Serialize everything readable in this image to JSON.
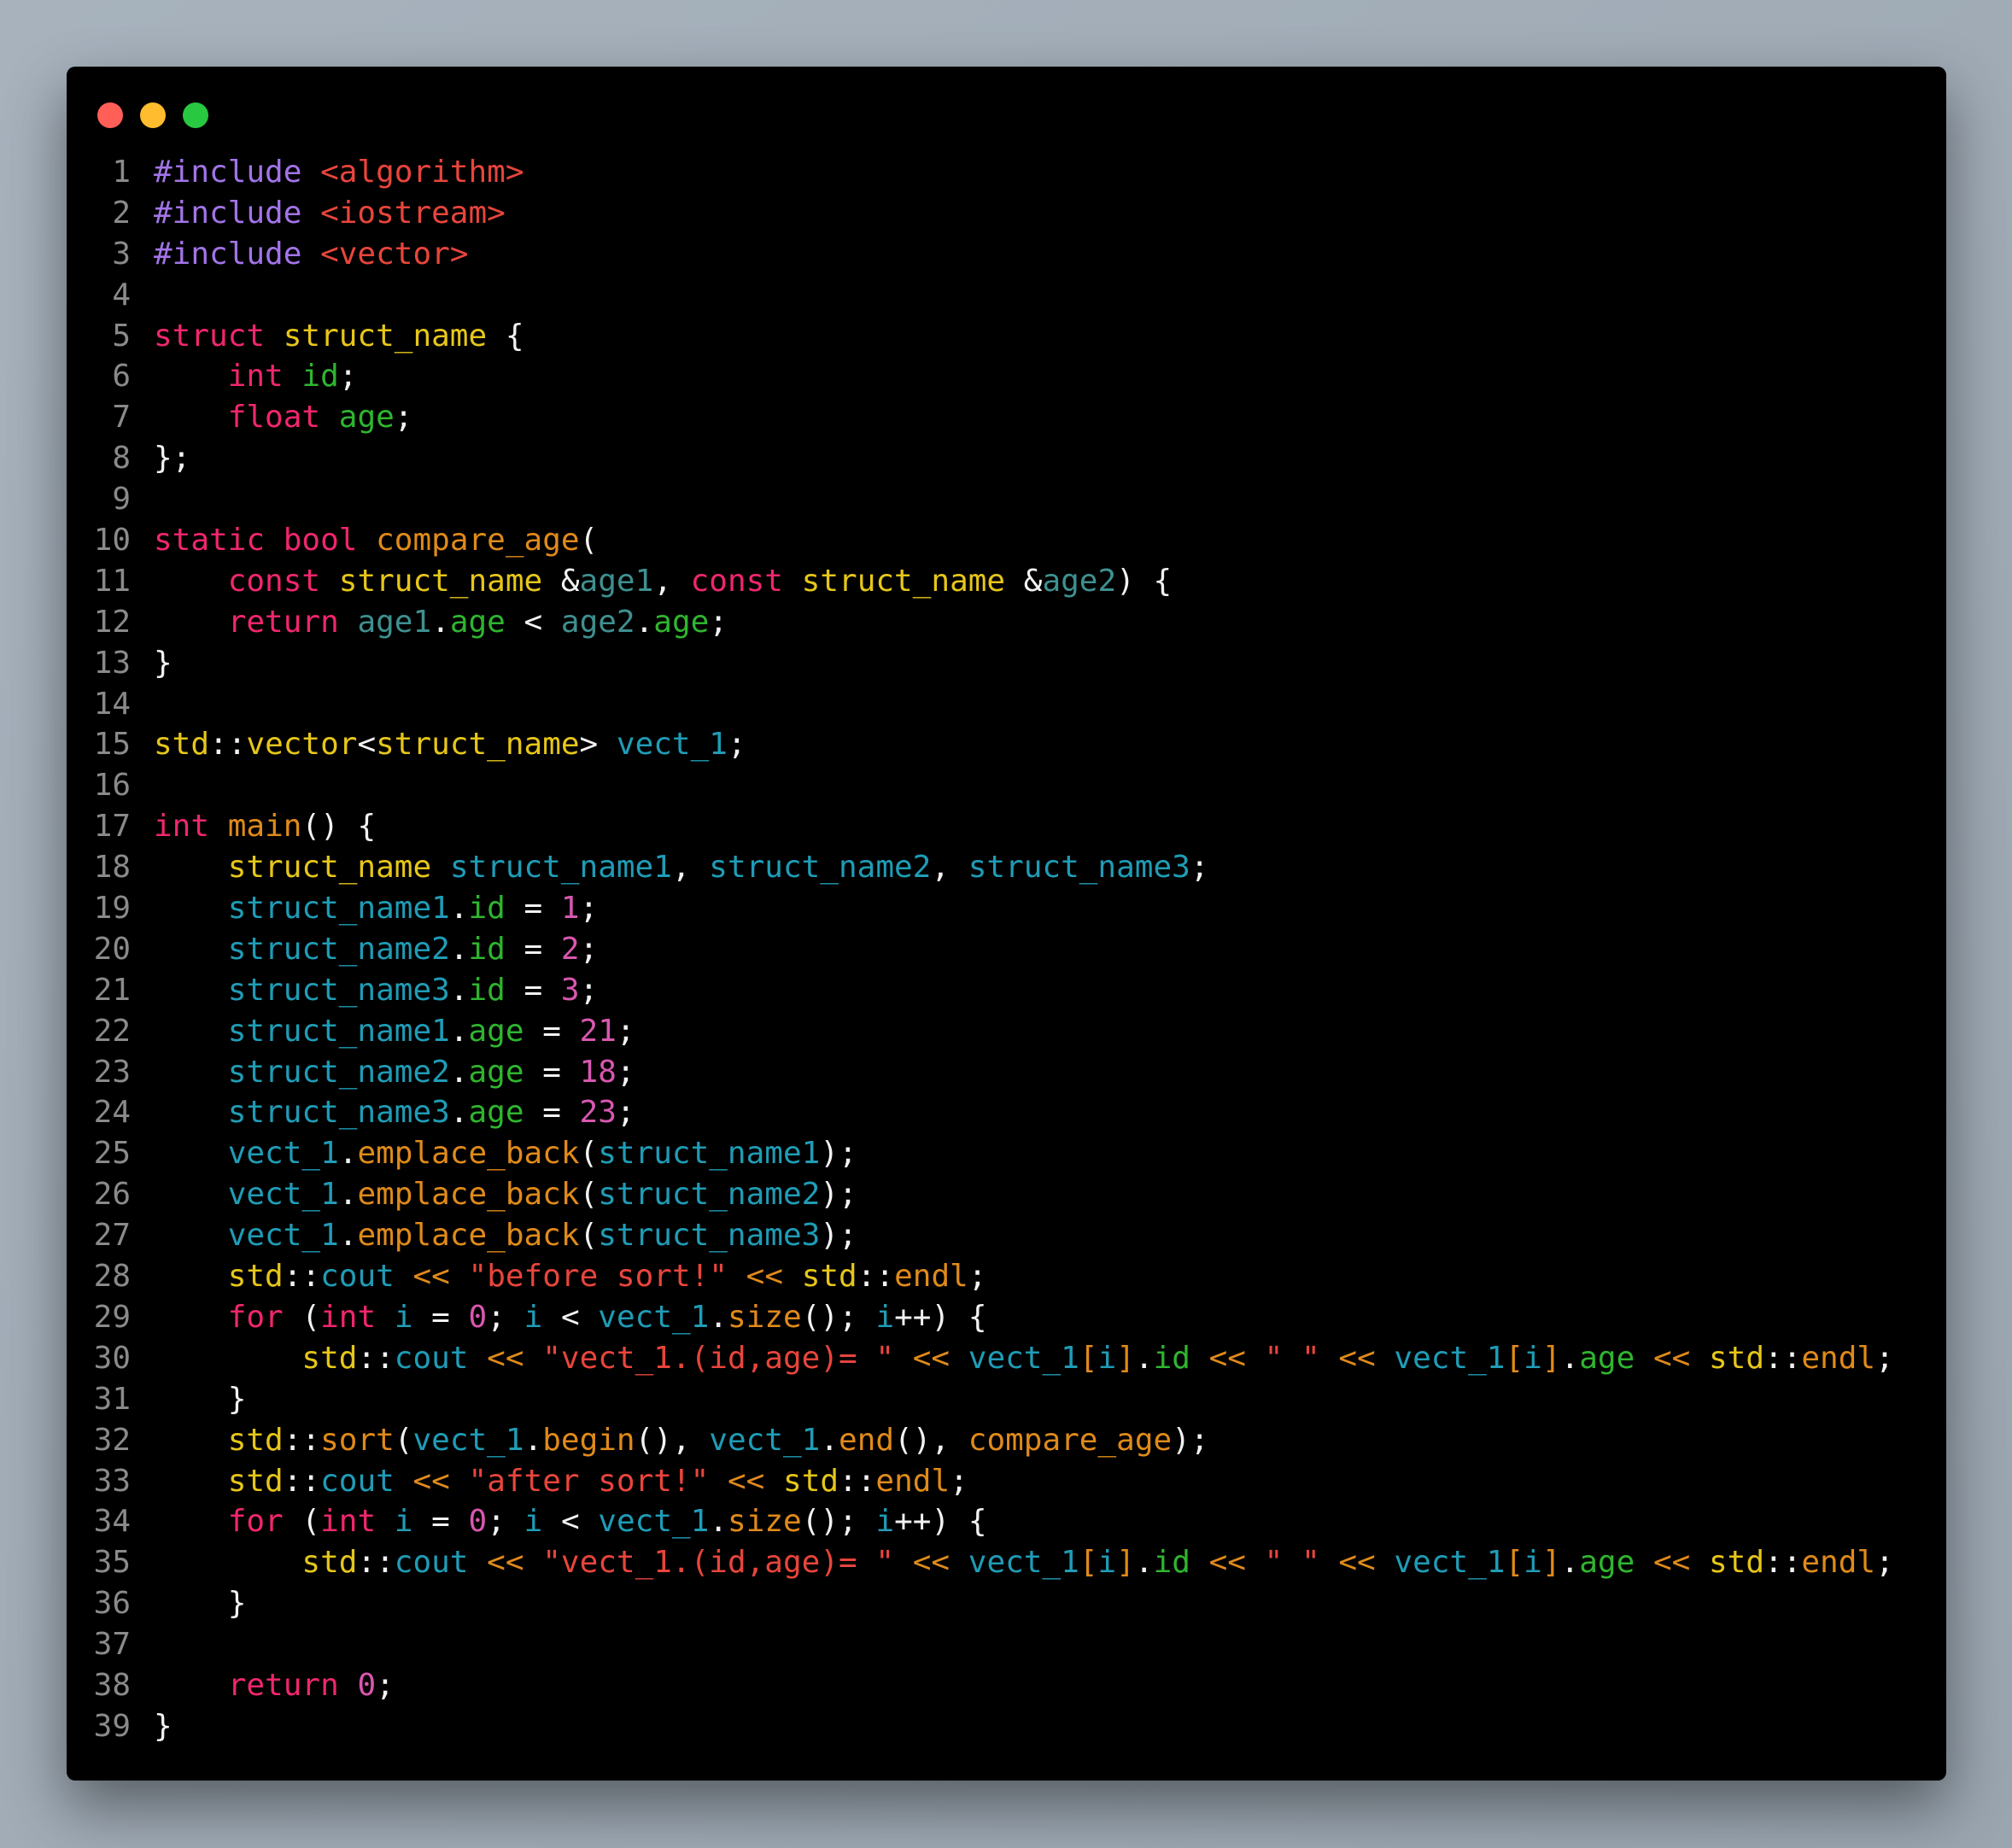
{
  "window": {
    "controls": [
      {
        "name": "close",
        "color": "#ff5f57"
      },
      {
        "name": "minimize",
        "color": "#febc2e"
      },
      {
        "name": "maximize",
        "color": "#28c840"
      }
    ]
  },
  "colors": {
    "keyword": "#f0266e",
    "type": "#e6c619",
    "function": "#e08a1a",
    "parameter": "#3f9090",
    "member": "#2fb52f",
    "variable": "#1f9cb6",
    "number": "#d957b0",
    "string": "#e8453c",
    "preprocessor": "#a274e8",
    "line_number": "#8a8a8a"
  },
  "code": {
    "language": "cpp",
    "lines": [
      [
        [
          "pp",
          "#include"
        ],
        [
          "pl",
          " "
        ],
        [
          "st",
          "<algorithm>"
        ]
      ],
      [
        [
          "pp",
          "#include"
        ],
        [
          "pl",
          " "
        ],
        [
          "st",
          "<iostream>"
        ]
      ],
      [
        [
          "pp",
          "#include"
        ],
        [
          "pl",
          " "
        ],
        [
          "st",
          "<vector>"
        ]
      ],
      [],
      [
        [
          "kw",
          "struct"
        ],
        [
          "pl",
          " "
        ],
        [
          "ty",
          "struct_name"
        ],
        [
          "pl",
          " {"
        ]
      ],
      [
        [
          "pl",
          "    "
        ],
        [
          "kw",
          "int"
        ],
        [
          "pl",
          " "
        ],
        [
          "me",
          "id"
        ],
        [
          "pl",
          ";"
        ]
      ],
      [
        [
          "pl",
          "    "
        ],
        [
          "kw",
          "float"
        ],
        [
          "pl",
          " "
        ],
        [
          "me",
          "age"
        ],
        [
          "pl",
          ";"
        ]
      ],
      [
        [
          "pl",
          "};"
        ]
      ],
      [],
      [
        [
          "kw",
          "static"
        ],
        [
          "pl",
          " "
        ],
        [
          "kw",
          "bool"
        ],
        [
          "pl",
          " "
        ],
        [
          "fn",
          "compare_age"
        ],
        [
          "pl",
          "("
        ]
      ],
      [
        [
          "pl",
          "    "
        ],
        [
          "kw",
          "const"
        ],
        [
          "pl",
          " "
        ],
        [
          "ty",
          "struct_name"
        ],
        [
          "pl",
          " &"
        ],
        [
          "pa",
          "age1"
        ],
        [
          "pl",
          ", "
        ],
        [
          "kw",
          "const"
        ],
        [
          "pl",
          " "
        ],
        [
          "ty",
          "struct_name"
        ],
        [
          "pl",
          " &"
        ],
        [
          "pa",
          "age2"
        ],
        [
          "pl",
          ") {"
        ]
      ],
      [
        [
          "pl",
          "    "
        ],
        [
          "kw",
          "return"
        ],
        [
          "pl",
          " "
        ],
        [
          "pa",
          "age1"
        ],
        [
          "pl",
          "."
        ],
        [
          "me",
          "age"
        ],
        [
          "pl",
          " < "
        ],
        [
          "pa",
          "age2"
        ],
        [
          "pl",
          "."
        ],
        [
          "me",
          "age"
        ],
        [
          "pl",
          ";"
        ]
      ],
      [
        [
          "pl",
          "}"
        ]
      ],
      [],
      [
        [
          "ns",
          "std"
        ],
        [
          "pl",
          "::"
        ],
        [
          "ty",
          "vector"
        ],
        [
          "pl",
          "<"
        ],
        [
          "ty",
          "struct_name"
        ],
        [
          "pl",
          "> "
        ],
        [
          "va",
          "vect_1"
        ],
        [
          "pl",
          ";"
        ]
      ],
      [],
      [
        [
          "kw",
          "int"
        ],
        [
          "pl",
          " "
        ],
        [
          "fn",
          "main"
        ],
        [
          "pl",
          "() {"
        ]
      ],
      [
        [
          "pl",
          "    "
        ],
        [
          "ty",
          "struct_name"
        ],
        [
          "pl",
          " "
        ],
        [
          "va",
          "struct_name1"
        ],
        [
          "pl",
          ", "
        ],
        [
          "va",
          "struct_name2"
        ],
        [
          "pl",
          ", "
        ],
        [
          "va",
          "struct_name3"
        ],
        [
          "pl",
          ";"
        ]
      ],
      [
        [
          "pl",
          "    "
        ],
        [
          "va",
          "struct_name1"
        ],
        [
          "pl",
          "."
        ],
        [
          "me",
          "id"
        ],
        [
          "pl",
          " = "
        ],
        [
          "nu",
          "1"
        ],
        [
          "pl",
          ";"
        ]
      ],
      [
        [
          "pl",
          "    "
        ],
        [
          "va",
          "struct_name2"
        ],
        [
          "pl",
          "."
        ],
        [
          "me",
          "id"
        ],
        [
          "pl",
          " = "
        ],
        [
          "nu",
          "2"
        ],
        [
          "pl",
          ";"
        ]
      ],
      [
        [
          "pl",
          "    "
        ],
        [
          "va",
          "struct_name3"
        ],
        [
          "pl",
          "."
        ],
        [
          "me",
          "id"
        ],
        [
          "pl",
          " = "
        ],
        [
          "nu",
          "3"
        ],
        [
          "pl",
          ";"
        ]
      ],
      [
        [
          "pl",
          "    "
        ],
        [
          "va",
          "struct_name1"
        ],
        [
          "pl",
          "."
        ],
        [
          "me",
          "age"
        ],
        [
          "pl",
          " = "
        ],
        [
          "nu",
          "21"
        ],
        [
          "pl",
          ";"
        ]
      ],
      [
        [
          "pl",
          "    "
        ],
        [
          "va",
          "struct_name2"
        ],
        [
          "pl",
          "."
        ],
        [
          "me",
          "age"
        ],
        [
          "pl",
          " = "
        ],
        [
          "nu",
          "18"
        ],
        [
          "pl",
          ";"
        ]
      ],
      [
        [
          "pl",
          "    "
        ],
        [
          "va",
          "struct_name3"
        ],
        [
          "pl",
          "."
        ],
        [
          "me",
          "age"
        ],
        [
          "pl",
          " = "
        ],
        [
          "nu",
          "23"
        ],
        [
          "pl",
          ";"
        ]
      ],
      [
        [
          "pl",
          "    "
        ],
        [
          "va",
          "vect_1"
        ],
        [
          "pl",
          "."
        ],
        [
          "fn",
          "emplace_back"
        ],
        [
          "pl",
          "("
        ],
        [
          "va",
          "struct_name1"
        ],
        [
          "pl",
          ");"
        ]
      ],
      [
        [
          "pl",
          "    "
        ],
        [
          "va",
          "vect_1"
        ],
        [
          "pl",
          "."
        ],
        [
          "fn",
          "emplace_back"
        ],
        [
          "pl",
          "("
        ],
        [
          "va",
          "struct_name2"
        ],
        [
          "pl",
          ");"
        ]
      ],
      [
        [
          "pl",
          "    "
        ],
        [
          "va",
          "vect_1"
        ],
        [
          "pl",
          "."
        ],
        [
          "fn",
          "emplace_back"
        ],
        [
          "pl",
          "("
        ],
        [
          "va",
          "struct_name3"
        ],
        [
          "pl",
          ");"
        ]
      ],
      [
        [
          "pl",
          "    "
        ],
        [
          "ns",
          "std"
        ],
        [
          "pl",
          "::"
        ],
        [
          "va",
          "cout"
        ],
        [
          "pl",
          " "
        ],
        [
          "op",
          "<<"
        ],
        [
          "pl",
          " "
        ],
        [
          "st",
          "\"before sort!\""
        ],
        [
          "pl",
          " "
        ],
        [
          "op",
          "<<"
        ],
        [
          "pl",
          " "
        ],
        [
          "ns",
          "std"
        ],
        [
          "pl",
          "::"
        ],
        [
          "fn",
          "endl"
        ],
        [
          "pl",
          ";"
        ]
      ],
      [
        [
          "pl",
          "    "
        ],
        [
          "kw",
          "for"
        ],
        [
          "pl",
          " ("
        ],
        [
          "kw",
          "int"
        ],
        [
          "pl",
          " "
        ],
        [
          "va",
          "i"
        ],
        [
          "pl",
          " = "
        ],
        [
          "nu",
          "0"
        ],
        [
          "pl",
          "; "
        ],
        [
          "va",
          "i"
        ],
        [
          "pl",
          " < "
        ],
        [
          "va",
          "vect_1"
        ],
        [
          "pl",
          "."
        ],
        [
          "fn",
          "size"
        ],
        [
          "pl",
          "(); "
        ],
        [
          "va",
          "i"
        ],
        [
          "pl",
          "++) {"
        ]
      ],
      [
        [
          "pl",
          "        "
        ],
        [
          "ns",
          "std"
        ],
        [
          "pl",
          "::"
        ],
        [
          "va",
          "cout"
        ],
        [
          "pl",
          " "
        ],
        [
          "op",
          "<<"
        ],
        [
          "pl",
          " "
        ],
        [
          "st",
          "\"vect_1.(id,age)= \""
        ],
        [
          "pl",
          " "
        ],
        [
          "op",
          "<<"
        ],
        [
          "pl",
          " "
        ],
        [
          "va",
          "vect_1"
        ],
        [
          "op",
          "["
        ],
        [
          "va",
          "i"
        ],
        [
          "op",
          "]"
        ],
        [
          "pl",
          "."
        ],
        [
          "me",
          "id"
        ],
        [
          "pl",
          " "
        ],
        [
          "op",
          "<<"
        ],
        [
          "pl",
          " "
        ],
        [
          "st",
          "\" \""
        ],
        [
          "pl",
          " "
        ],
        [
          "op",
          "<<"
        ],
        [
          "pl",
          " "
        ],
        [
          "va",
          "vect_1"
        ],
        [
          "op",
          "["
        ],
        [
          "va",
          "i"
        ],
        [
          "op",
          "]"
        ],
        [
          "pl",
          "."
        ],
        [
          "me",
          "age"
        ],
        [
          "pl",
          " "
        ],
        [
          "op",
          "<<"
        ],
        [
          "pl",
          " "
        ],
        [
          "ns",
          "std"
        ],
        [
          "pl",
          "::"
        ],
        [
          "fn",
          "endl"
        ],
        [
          "pl",
          ";"
        ]
      ],
      [
        [
          "pl",
          "    }"
        ]
      ],
      [
        [
          "pl",
          "    "
        ],
        [
          "ns",
          "std"
        ],
        [
          "pl",
          "::"
        ],
        [
          "fn",
          "sort"
        ],
        [
          "pl",
          "("
        ],
        [
          "va",
          "vect_1"
        ],
        [
          "pl",
          "."
        ],
        [
          "fn",
          "begin"
        ],
        [
          "pl",
          "(), "
        ],
        [
          "va",
          "vect_1"
        ],
        [
          "pl",
          "."
        ],
        [
          "fn",
          "end"
        ],
        [
          "pl",
          "(), "
        ],
        [
          "fn",
          "compare_age"
        ],
        [
          "pl",
          ");"
        ]
      ],
      [
        [
          "pl",
          "    "
        ],
        [
          "ns",
          "std"
        ],
        [
          "pl",
          "::"
        ],
        [
          "va",
          "cout"
        ],
        [
          "pl",
          " "
        ],
        [
          "op",
          "<<"
        ],
        [
          "pl",
          " "
        ],
        [
          "st",
          "\"after sort!\""
        ],
        [
          "pl",
          " "
        ],
        [
          "op",
          "<<"
        ],
        [
          "pl",
          " "
        ],
        [
          "ns",
          "std"
        ],
        [
          "pl",
          "::"
        ],
        [
          "fn",
          "endl"
        ],
        [
          "pl",
          ";"
        ]
      ],
      [
        [
          "pl",
          "    "
        ],
        [
          "kw",
          "for"
        ],
        [
          "pl",
          " ("
        ],
        [
          "kw",
          "int"
        ],
        [
          "pl",
          " "
        ],
        [
          "va",
          "i"
        ],
        [
          "pl",
          " = "
        ],
        [
          "nu",
          "0"
        ],
        [
          "pl",
          "; "
        ],
        [
          "va",
          "i"
        ],
        [
          "pl",
          " < "
        ],
        [
          "va",
          "vect_1"
        ],
        [
          "pl",
          "."
        ],
        [
          "fn",
          "size"
        ],
        [
          "pl",
          "(); "
        ],
        [
          "va",
          "i"
        ],
        [
          "pl",
          "++) {"
        ]
      ],
      [
        [
          "pl",
          "        "
        ],
        [
          "ns",
          "std"
        ],
        [
          "pl",
          "::"
        ],
        [
          "va",
          "cout"
        ],
        [
          "pl",
          " "
        ],
        [
          "op",
          "<<"
        ],
        [
          "pl",
          " "
        ],
        [
          "st",
          "\"vect_1.(id,age)= \""
        ],
        [
          "pl",
          " "
        ],
        [
          "op",
          "<<"
        ],
        [
          "pl",
          " "
        ],
        [
          "va",
          "vect_1"
        ],
        [
          "op",
          "["
        ],
        [
          "va",
          "i"
        ],
        [
          "op",
          "]"
        ],
        [
          "pl",
          "."
        ],
        [
          "me",
          "id"
        ],
        [
          "pl",
          " "
        ],
        [
          "op",
          "<<"
        ],
        [
          "pl",
          " "
        ],
        [
          "st",
          "\" \""
        ],
        [
          "pl",
          " "
        ],
        [
          "op",
          "<<"
        ],
        [
          "pl",
          " "
        ],
        [
          "va",
          "vect_1"
        ],
        [
          "op",
          "["
        ],
        [
          "va",
          "i"
        ],
        [
          "op",
          "]"
        ],
        [
          "pl",
          "."
        ],
        [
          "me",
          "age"
        ],
        [
          "pl",
          " "
        ],
        [
          "op",
          "<<"
        ],
        [
          "pl",
          " "
        ],
        [
          "ns",
          "std"
        ],
        [
          "pl",
          "::"
        ],
        [
          "fn",
          "endl"
        ],
        [
          "pl",
          ";"
        ]
      ],
      [
        [
          "pl",
          "    }"
        ]
      ],
      [],
      [
        [
          "pl",
          "    "
        ],
        [
          "kw",
          "return"
        ],
        [
          "pl",
          " "
        ],
        [
          "nu",
          "0"
        ],
        [
          "pl",
          ";"
        ]
      ],
      [
        [
          "pl",
          "}"
        ]
      ]
    ]
  }
}
